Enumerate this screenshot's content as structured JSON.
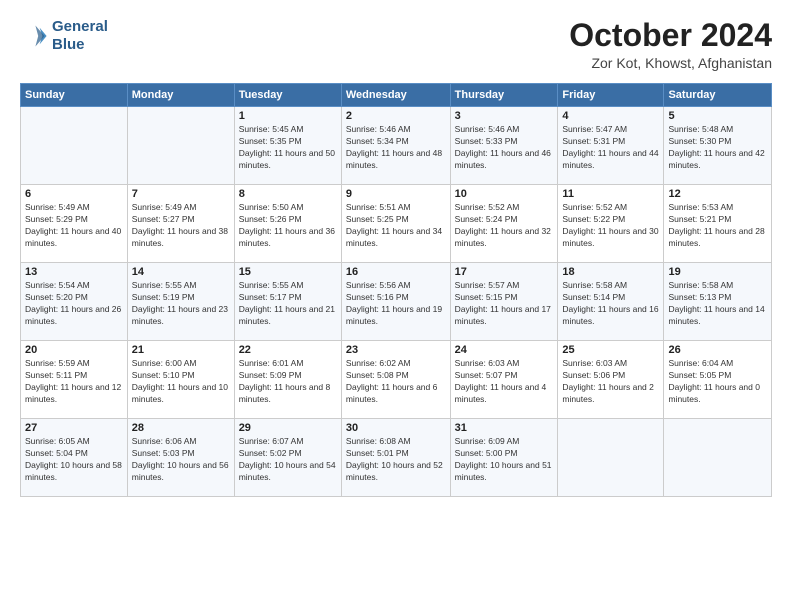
{
  "header": {
    "logo_line1": "General",
    "logo_line2": "Blue",
    "month_title": "October 2024",
    "location": "Zor Kot, Khowst, Afghanistan"
  },
  "days_of_week": [
    "Sunday",
    "Monday",
    "Tuesday",
    "Wednesday",
    "Thursday",
    "Friday",
    "Saturday"
  ],
  "weeks": [
    [
      {
        "day": "",
        "info": ""
      },
      {
        "day": "",
        "info": ""
      },
      {
        "day": "1",
        "info": "Sunrise: 5:45 AM\nSunset: 5:35 PM\nDaylight: 11 hours and 50 minutes."
      },
      {
        "day": "2",
        "info": "Sunrise: 5:46 AM\nSunset: 5:34 PM\nDaylight: 11 hours and 48 minutes."
      },
      {
        "day": "3",
        "info": "Sunrise: 5:46 AM\nSunset: 5:33 PM\nDaylight: 11 hours and 46 minutes."
      },
      {
        "day": "4",
        "info": "Sunrise: 5:47 AM\nSunset: 5:31 PM\nDaylight: 11 hours and 44 minutes."
      },
      {
        "day": "5",
        "info": "Sunrise: 5:48 AM\nSunset: 5:30 PM\nDaylight: 11 hours and 42 minutes."
      }
    ],
    [
      {
        "day": "6",
        "info": "Sunrise: 5:49 AM\nSunset: 5:29 PM\nDaylight: 11 hours and 40 minutes."
      },
      {
        "day": "7",
        "info": "Sunrise: 5:49 AM\nSunset: 5:27 PM\nDaylight: 11 hours and 38 minutes."
      },
      {
        "day": "8",
        "info": "Sunrise: 5:50 AM\nSunset: 5:26 PM\nDaylight: 11 hours and 36 minutes."
      },
      {
        "day": "9",
        "info": "Sunrise: 5:51 AM\nSunset: 5:25 PM\nDaylight: 11 hours and 34 minutes."
      },
      {
        "day": "10",
        "info": "Sunrise: 5:52 AM\nSunset: 5:24 PM\nDaylight: 11 hours and 32 minutes."
      },
      {
        "day": "11",
        "info": "Sunrise: 5:52 AM\nSunset: 5:22 PM\nDaylight: 11 hours and 30 minutes."
      },
      {
        "day": "12",
        "info": "Sunrise: 5:53 AM\nSunset: 5:21 PM\nDaylight: 11 hours and 28 minutes."
      }
    ],
    [
      {
        "day": "13",
        "info": "Sunrise: 5:54 AM\nSunset: 5:20 PM\nDaylight: 11 hours and 26 minutes."
      },
      {
        "day": "14",
        "info": "Sunrise: 5:55 AM\nSunset: 5:19 PM\nDaylight: 11 hours and 23 minutes."
      },
      {
        "day": "15",
        "info": "Sunrise: 5:55 AM\nSunset: 5:17 PM\nDaylight: 11 hours and 21 minutes."
      },
      {
        "day": "16",
        "info": "Sunrise: 5:56 AM\nSunset: 5:16 PM\nDaylight: 11 hours and 19 minutes."
      },
      {
        "day": "17",
        "info": "Sunrise: 5:57 AM\nSunset: 5:15 PM\nDaylight: 11 hours and 17 minutes."
      },
      {
        "day": "18",
        "info": "Sunrise: 5:58 AM\nSunset: 5:14 PM\nDaylight: 11 hours and 16 minutes."
      },
      {
        "day": "19",
        "info": "Sunrise: 5:58 AM\nSunset: 5:13 PM\nDaylight: 11 hours and 14 minutes."
      }
    ],
    [
      {
        "day": "20",
        "info": "Sunrise: 5:59 AM\nSunset: 5:11 PM\nDaylight: 11 hours and 12 minutes."
      },
      {
        "day": "21",
        "info": "Sunrise: 6:00 AM\nSunset: 5:10 PM\nDaylight: 11 hours and 10 minutes."
      },
      {
        "day": "22",
        "info": "Sunrise: 6:01 AM\nSunset: 5:09 PM\nDaylight: 11 hours and 8 minutes."
      },
      {
        "day": "23",
        "info": "Sunrise: 6:02 AM\nSunset: 5:08 PM\nDaylight: 11 hours and 6 minutes."
      },
      {
        "day": "24",
        "info": "Sunrise: 6:03 AM\nSunset: 5:07 PM\nDaylight: 11 hours and 4 minutes."
      },
      {
        "day": "25",
        "info": "Sunrise: 6:03 AM\nSunset: 5:06 PM\nDaylight: 11 hours and 2 minutes."
      },
      {
        "day": "26",
        "info": "Sunrise: 6:04 AM\nSunset: 5:05 PM\nDaylight: 11 hours and 0 minutes."
      }
    ],
    [
      {
        "day": "27",
        "info": "Sunrise: 6:05 AM\nSunset: 5:04 PM\nDaylight: 10 hours and 58 minutes."
      },
      {
        "day": "28",
        "info": "Sunrise: 6:06 AM\nSunset: 5:03 PM\nDaylight: 10 hours and 56 minutes."
      },
      {
        "day": "29",
        "info": "Sunrise: 6:07 AM\nSunset: 5:02 PM\nDaylight: 10 hours and 54 minutes."
      },
      {
        "day": "30",
        "info": "Sunrise: 6:08 AM\nSunset: 5:01 PM\nDaylight: 10 hours and 52 minutes."
      },
      {
        "day": "31",
        "info": "Sunrise: 6:09 AM\nSunset: 5:00 PM\nDaylight: 10 hours and 51 minutes."
      },
      {
        "day": "",
        "info": ""
      },
      {
        "day": "",
        "info": ""
      }
    ]
  ]
}
